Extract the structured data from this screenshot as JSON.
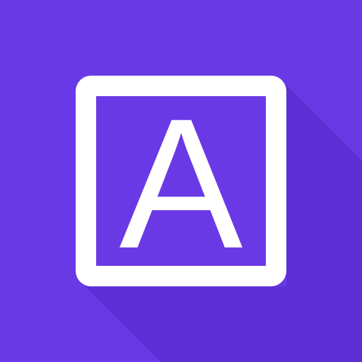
{
  "app_icon": {
    "letter": "A",
    "colors": {
      "background": "#6a39e6",
      "foreground": "#ffffff",
      "shadow": "#5a2fd0"
    },
    "icon_name": "letter-a-square-icon"
  }
}
